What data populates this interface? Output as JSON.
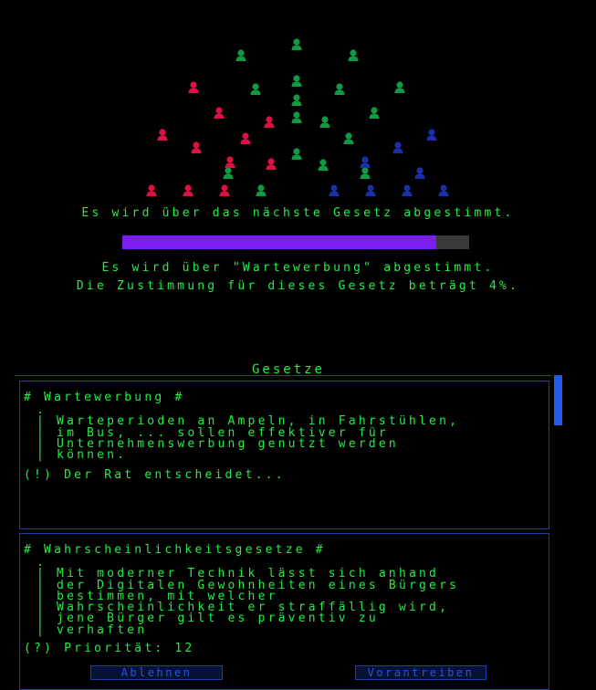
{
  "colors": {
    "text": "#22ee44",
    "green_seat": "#119944",
    "red_seat": "#dd1144",
    "blue_seat": "#1a2fa8",
    "progress_fill": "#7a1ff0",
    "progress_track": "#3a3a3a",
    "border": "#1b3fa8"
  },
  "parliament": {
    "seats_red": 11,
    "seats_green": 17,
    "seats_blue": 8
  },
  "status": {
    "headline": "Es wird über das nächste Gesetz abgestimmt.",
    "vote_line": "Es wird über \"Wartewerbung\" abgestimmt.",
    "approval_line": "Die Zustimmung für dieses Gesetz beträgt 4%.",
    "progress_fraction": 0.905
  },
  "laws_panel": {
    "title": "Gesetze",
    "laws": [
      {
        "title": "# Wartewerbung #",
        "description": ".\n| Warteperioden an Ampeln, in Fahrstühlen,\n| im Bus, ... sollen effektiver für\n| Unternehmenswerbung genutzt werden\n| können.",
        "status": "(!) Der Rat entscheidet..."
      },
      {
        "title": "# Wahrscheinlichkeitsgesetze #",
        "description": ".\n| Mit moderner Technik lässt sich anhand\n| der Digitalen Gewohnheiten eines Bürgers\n| bestimmen, mit welcher\n| Wahrscheinlichkeit er straffällig wird,\n| jene Bürger gilt es präventiv zu\n| verhaften",
        "status": "(?) Priorität: 12"
      }
    ],
    "button_left": "Ablehnen",
    "button_right": "Vorantreiben"
  }
}
